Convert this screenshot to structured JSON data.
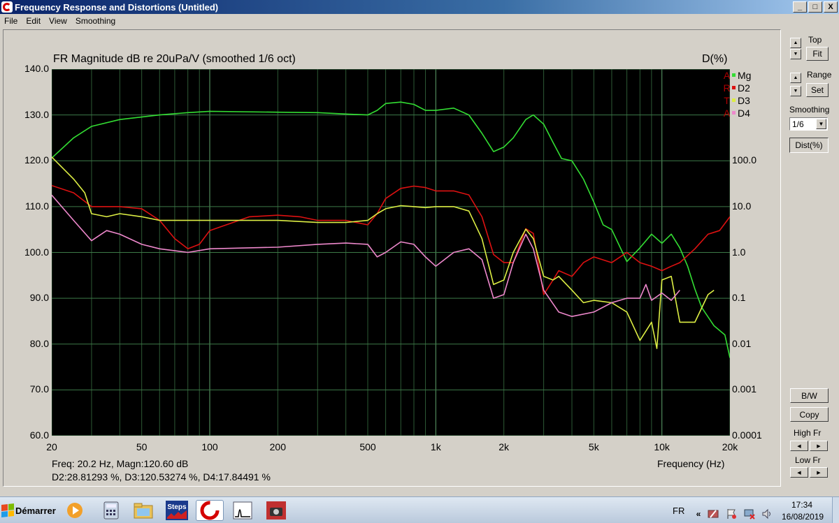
{
  "window": {
    "title": "Frequency Response and Distortions (Untitled)",
    "minimize": "_",
    "maximize": "□",
    "close": "X"
  },
  "menu": [
    "File",
    "Edit",
    "View",
    "Smoothing"
  ],
  "plot": {
    "title": "FR Magnitude dB re 20uPa/V (smoothed 1/6 oct)",
    "right_title": "D(%)",
    "xlabel": "Frequency (Hz)",
    "left_ticks": [
      "140.0",
      "130.0",
      "120.0",
      "110.0",
      "100.0",
      "90.0",
      "80.0",
      "70.0",
      "60.0"
    ],
    "right_ticks": [
      "100.0",
      "10.0",
      "1.0",
      "0.1",
      "0.01",
      "0.001",
      "0.0001"
    ],
    "x_ticks": [
      "20",
      "50",
      "100",
      "200",
      "500",
      "1k",
      "2k",
      "5k",
      "10k",
      "20k"
    ],
    "readout_line1": "Freq: 20.2 Hz, Magn:120.60 dB",
    "readout_line2": "D2:28.81293 %, D3:120.53274 %, D4:17.84491 %",
    "legend": [
      {
        "letter": "A",
        "name": "Mg",
        "color": "#33dd33"
      },
      {
        "letter": "R",
        "name": "D2",
        "color": "#dd1111"
      },
      {
        "letter": "T",
        "name": "D3",
        "color": "#ddee44"
      },
      {
        "letter": "A",
        "name": "D4",
        "color": "#ee88cc"
      }
    ]
  },
  "chart_data": {
    "type": "line",
    "title": "FR Magnitude dB re 20uPa/V (smoothed 1/6 oct)",
    "xlabel": "Frequency (Hz)",
    "ylabel_left": "dB",
    "ylabel_right": "D(%)",
    "x_scale": "log",
    "xlim": [
      20,
      20000
    ],
    "ylim_left": [
      60,
      140
    ],
    "ylim_right_log": [
      0.0001,
      100
    ],
    "grid": true,
    "legend_position": "top-right",
    "series": [
      {
        "name": "Mg",
        "axis": "left_dB",
        "color": "#33dd33",
        "points": [
          [
            20,
            120.6
          ],
          [
            25,
            125
          ],
          [
            30,
            127.5
          ],
          [
            40,
            129
          ],
          [
            60,
            130
          ],
          [
            80,
            130.5
          ],
          [
            100,
            130.8
          ],
          [
            200,
            130.6
          ],
          [
            300,
            130.5
          ],
          [
            400,
            130.2
          ],
          [
            500,
            130
          ],
          [
            550,
            131
          ],
          [
            600,
            132.5
          ],
          [
            700,
            132.8
          ],
          [
            800,
            132.3
          ],
          [
            900,
            131
          ],
          [
            1000,
            131
          ],
          [
            1200,
            131.5
          ],
          [
            1400,
            130
          ],
          [
            1600,
            126
          ],
          [
            1800,
            122
          ],
          [
            2000,
            123
          ],
          [
            2200,
            125
          ],
          [
            2500,
            129
          ],
          [
            2700,
            130
          ],
          [
            3000,
            128
          ],
          [
            3300,
            124
          ],
          [
            3600,
            120.5
          ],
          [
            4000,
            120
          ],
          [
            4500,
            116
          ],
          [
            5000,
            111
          ],
          [
            5500,
            106
          ],
          [
            6000,
            105
          ],
          [
            7000,
            98
          ],
          [
            8000,
            101
          ],
          [
            9000,
            104
          ],
          [
            10000,
            102
          ],
          [
            11000,
            104
          ],
          [
            12000,
            101
          ],
          [
            13000,
            97
          ],
          [
            14000,
            92
          ],
          [
            15000,
            88
          ],
          [
            17000,
            84
          ],
          [
            19000,
            82
          ],
          [
            20000,
            77
          ]
        ]
      },
      {
        "name": "D2",
        "axis": "right_percent",
        "color": "#dd1111",
        "points": [
          [
            20,
            28.8
          ],
          [
            25,
            20
          ],
          [
            30,
            10
          ],
          [
            40,
            10
          ],
          [
            50,
            9
          ],
          [
            60,
            5
          ],
          [
            70,
            2
          ],
          [
            80,
            1.2
          ],
          [
            90,
            1.5
          ],
          [
            100,
            3
          ],
          [
            150,
            6
          ],
          [
            200,
            6.5
          ],
          [
            250,
            6
          ],
          [
            300,
            5
          ],
          [
            400,
            5
          ],
          [
            500,
            4
          ],
          [
            550,
            7
          ],
          [
            600,
            15
          ],
          [
            700,
            25
          ],
          [
            800,
            28
          ],
          [
            900,
            26
          ],
          [
            1000,
            22
          ],
          [
            1200,
            22
          ],
          [
            1400,
            18
          ],
          [
            1600,
            6
          ],
          [
            1800,
            0.9
          ],
          [
            2000,
            0.6
          ],
          [
            2200,
            0.6
          ],
          [
            2500,
            3.3
          ],
          [
            2700,
            2.6
          ],
          [
            3000,
            0.12
          ],
          [
            3300,
            0.25
          ],
          [
            3500,
            0.4
          ],
          [
            4000,
            0.3
          ],
          [
            4500,
            0.6
          ],
          [
            5000,
            0.8
          ],
          [
            6000,
            0.6
          ],
          [
            7000,
            1
          ],
          [
            8000,
            0.6
          ],
          [
            9000,
            0.5
          ],
          [
            10000,
            0.4
          ],
          [
            11000,
            0.5
          ],
          [
            12000,
            0.6
          ],
          [
            14000,
            1.2
          ],
          [
            16000,
            2.5
          ],
          [
            18000,
            3
          ],
          [
            20000,
            6
          ]
        ]
      },
      {
        "name": "D3",
        "axis": "right_percent",
        "color": "#ddee44",
        "points": [
          [
            20,
            120.5
          ],
          [
            25,
            40
          ],
          [
            28,
            20
          ],
          [
            30,
            7
          ],
          [
            35,
            6
          ],
          [
            40,
            7
          ],
          [
            50,
            6
          ],
          [
            60,
            5
          ],
          [
            80,
            5
          ],
          [
            100,
            5
          ],
          [
            200,
            5
          ],
          [
            300,
            4.5
          ],
          [
            400,
            4.5
          ],
          [
            500,
            5
          ],
          [
            550,
            7
          ],
          [
            600,
            9
          ],
          [
            700,
            10.5
          ],
          [
            800,
            10
          ],
          [
            900,
            9.5
          ],
          [
            1000,
            10
          ],
          [
            1200,
            10
          ],
          [
            1400,
            8
          ],
          [
            1600,
            2
          ],
          [
            1800,
            0.2
          ],
          [
            2000,
            0.25
          ],
          [
            2200,
            1
          ],
          [
            2500,
            3.2
          ],
          [
            2700,
            2
          ],
          [
            3000,
            0.3
          ],
          [
            3300,
            0.25
          ],
          [
            3500,
            0.3
          ],
          [
            4000,
            0.15
          ],
          [
            4500,
            0.08
          ],
          [
            5000,
            0.09
          ],
          [
            6000,
            0.08
          ],
          [
            7000,
            0.05
          ],
          [
            8000,
            0.012
          ],
          [
            9000,
            0.03
          ],
          [
            9500,
            0.008
          ],
          [
            10000,
            0.25
          ],
          [
            11000,
            0.3
          ],
          [
            12000,
            0.03
          ],
          [
            14000,
            0.03
          ],
          [
            16000,
            0.12
          ],
          [
            17000,
            0.15
          ]
        ]
      },
      {
        "name": "D4",
        "axis": "right_percent",
        "color": "#ee88cc",
        "points": [
          [
            20,
            17.8
          ],
          [
            25,
            5
          ],
          [
            30,
            1.8
          ],
          [
            35,
            3
          ],
          [
            40,
            2.5
          ],
          [
            50,
            1.5
          ],
          [
            60,
            1.2
          ],
          [
            80,
            1
          ],
          [
            100,
            1.2
          ],
          [
            200,
            1.3
          ],
          [
            300,
            1.5
          ],
          [
            400,
            1.6
          ],
          [
            500,
            1.5
          ],
          [
            550,
            0.8
          ],
          [
            600,
            1
          ],
          [
            700,
            1.7
          ],
          [
            800,
            1.5
          ],
          [
            900,
            0.8
          ],
          [
            1000,
            0.5
          ],
          [
            1200,
            1
          ],
          [
            1400,
            1.2
          ],
          [
            1600,
            0.7
          ],
          [
            1800,
            0.1
          ],
          [
            2000,
            0.12
          ],
          [
            2200,
            0.6
          ],
          [
            2500,
            2.5
          ],
          [
            2700,
            1.2
          ],
          [
            3000,
            0.15
          ],
          [
            3500,
            0.05
          ],
          [
            4000,
            0.04
          ],
          [
            5000,
            0.05
          ],
          [
            6000,
            0.08
          ],
          [
            7000,
            0.1
          ],
          [
            8000,
            0.1
          ],
          [
            8500,
            0.2
          ],
          [
            9000,
            0.09
          ],
          [
            10000,
            0.13
          ],
          [
            11000,
            0.09
          ],
          [
            12000,
            0.15
          ]
        ]
      }
    ]
  },
  "panel": {
    "top_label": "Top",
    "fit_label": "Fit",
    "range_label": "Range",
    "set_label": "Set",
    "smoothing_label": "Smoothing",
    "smoothing_value": "1/6",
    "dist_label": "Dist(%)",
    "bw_label": "B/W",
    "copy_label": "Copy",
    "high_fr_label": "High Fr",
    "low_fr_label": "Low Fr"
  },
  "taskbar": {
    "start_label": "Démarrer",
    "lang": "FR",
    "time": "17:34",
    "date": "16/08/2019",
    "steps_label": "Steps",
    "expand_label": "«"
  }
}
